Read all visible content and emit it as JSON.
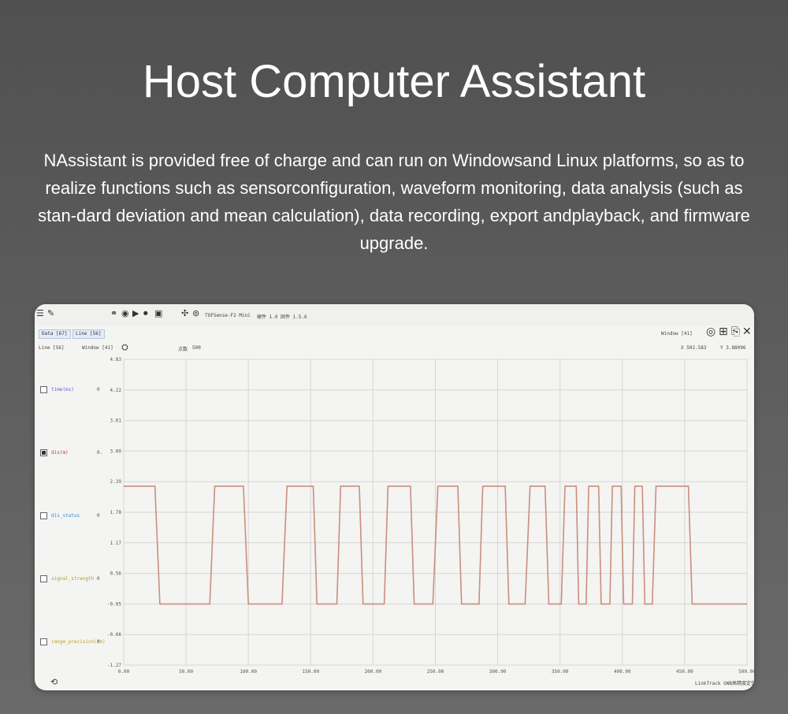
{
  "header": {
    "title": "Host Computer Assistant",
    "description": "NAssistant is provided free of charge and can run on Windowsand Linux platforms, so as to realize functions such as sensorconfiguration, waveform monitoring, data analysis (such as stan-dard deviation and mean calculation), data recording, export andplayback, and firmware upgrade."
  },
  "app": {
    "toolbar": {
      "device_label": "TOFSense-F2 Mini",
      "hw_label": "硬件 1.0",
      "fw_label": "固件 1.5.6"
    },
    "tabs": [
      "Data [67]",
      "Line [56]"
    ],
    "line_toolbar": {
      "line_label": "Line [56]",
      "window_label": "Window [41]",
      "points_label": "点数",
      "points_value": "500"
    },
    "right_panel": {
      "window_label": "Window [41]",
      "x_readout": "X 502.583",
      "y_readout": "Y 3.88096"
    },
    "channels": [
      {
        "label": "time(ms)",
        "value": "0",
        "checked": false,
        "color": "#6a5acd"
      },
      {
        "label": "dis(m)",
        "value": "0.",
        "checked": true,
        "color": "#c04030"
      },
      {
        "label": "dis_status",
        "value": "0",
        "checked": false,
        "color": "#3a8fd0"
      },
      {
        "label": "signal_strength",
        "value": "0",
        "checked": false,
        "color": "#b0a020"
      },
      {
        "label": "range_precision(cm)",
        "value": "0",
        "checked": false,
        "color": "#c0a020"
      }
    ],
    "footer": {
      "brand": "LinkTrack UWB高精度定位"
    }
  },
  "chart_data": {
    "type": "line",
    "title": "",
    "xlabel": "",
    "ylabel": "",
    "xlim": [
      0,
      500
    ],
    "ylim": [
      -1.27,
      4.83
    ],
    "x_ticks": [
      "0.00",
      "50.00",
      "100.00",
      "150.00",
      "200.00",
      "250.00",
      "300.00",
      "350.00",
      "400.00",
      "450.00",
      "500.00"
    ],
    "y_ticks": [
      "4.83",
      "4.22",
      "3.61",
      "3.00",
      "2.39",
      "1.78",
      "1.17",
      "0.56",
      "-0.05",
      "-0.66",
      "-1.27"
    ],
    "grid": true,
    "series": [
      {
        "color": "#c98f7e",
        "x": [
          0,
          25,
          29,
          69,
          73,
          96,
          100,
          127,
          131,
          152,
          155,
          171,
          174,
          189,
          192,
          209,
          212,
          230,
          233,
          248,
          252,
          268,
          271,
          285,
          288,
          306,
          309,
          322,
          326,
          338,
          341,
          351,
          354,
          363,
          365,
          371,
          373,
          381,
          383,
          390,
          392,
          399,
          401,
          408,
          410,
          416,
          418,
          424,
          427,
          453,
          456,
          500
        ],
        "y": [
          2.3,
          2.3,
          -0.05,
          -0.05,
          2.3,
          2.3,
          -0.05,
          -0.05,
          2.3,
          2.3,
          -0.05,
          -0.05,
          2.3,
          2.3,
          -0.05,
          -0.05,
          2.3,
          2.3,
          -0.05,
          -0.05,
          2.3,
          2.3,
          -0.05,
          -0.05,
          2.3,
          2.3,
          -0.05,
          -0.05,
          2.3,
          2.3,
          -0.05,
          -0.05,
          2.3,
          2.3,
          -0.05,
          -0.05,
          2.3,
          2.3,
          -0.05,
          -0.05,
          2.3,
          2.3,
          -0.05,
          -0.05,
          2.3,
          2.3,
          -0.05,
          -0.05,
          2.3,
          2.3,
          -0.05,
          -0.05
        ]
      }
    ]
  }
}
